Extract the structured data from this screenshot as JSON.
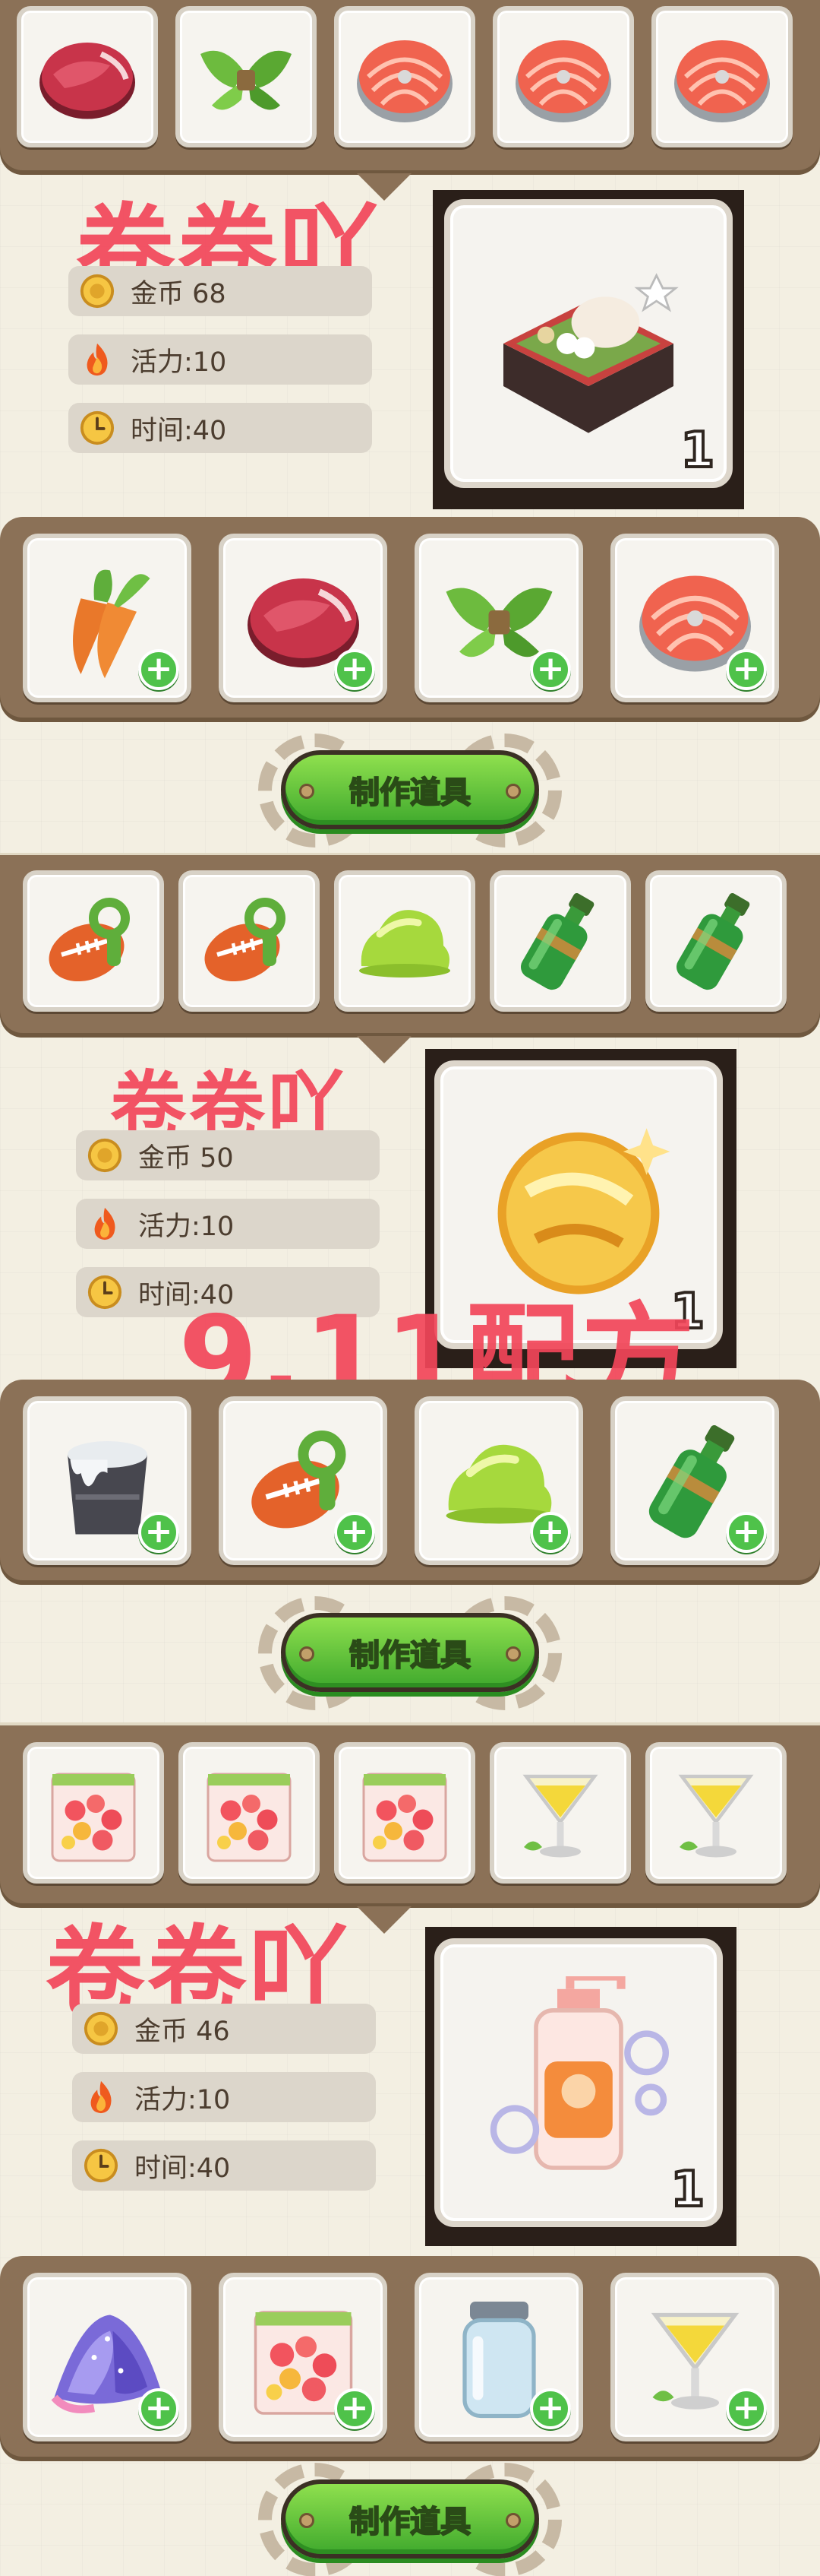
{
  "recipes": [
    {
      "watermark": "卷卷吖",
      "ingredients_top": [
        "raw-meat",
        "green-herb-bundle",
        "salmon-steak",
        "salmon-steak",
        "salmon-steak"
      ],
      "coins": "金币 68",
      "energy": "活力:10",
      "time": "时间:40",
      "product_icon": "bento-box",
      "product_count": "1",
      "requirements": [
        "carrot",
        "raw-meat",
        "green-herb-bundle",
        "salmon-steak"
      ],
      "button": "制作道具"
    },
    {
      "watermark": "卷卷吖",
      "overlay": "9.11配方",
      "ingredients_top": [
        "orange-football-whistle",
        "orange-football-whistle",
        "green-slime",
        "green-bottle",
        "green-bottle"
      ],
      "coins": "金币 50",
      "energy": "活力:10",
      "time": "时间:40",
      "product_icon": "golden-orb",
      "product_count": "1",
      "requirements": [
        "milk-bucket",
        "orange-football-whistle",
        "green-slime",
        "green-bottle"
      ],
      "button": "制作道具"
    },
    {
      "watermark": "卷卷吖",
      "ingredients_top": [
        "fruit-bag",
        "fruit-bag",
        "fruit-bag",
        "cocktail-glass",
        "cocktail-glass"
      ],
      "coins": "金币 46",
      "energy": "活力:10",
      "time": "时间:40",
      "product_icon": "bubble-soap-bottle",
      "product_count": "1",
      "requirements": [
        "galaxy-powder",
        "fruit-bag",
        "glass-jar",
        "cocktail-glass"
      ],
      "button": "制作道具"
    }
  ],
  "colors": {
    "tray": "#8b7157",
    "watermark": "#f2465a",
    "button_green": "#4fc24a"
  }
}
